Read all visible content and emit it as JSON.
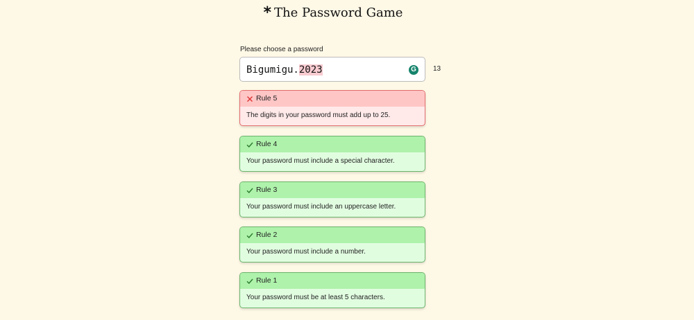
{
  "header": {
    "star": "*",
    "title": "The Password Game"
  },
  "password": {
    "label": "Please choose a password",
    "value_plain": "Bigumigu.",
    "value_highlighted": "2023",
    "char_count": "13",
    "assistant_icon": "G"
  },
  "rules": [
    {
      "status": "fail",
      "title": "Rule 5",
      "text": "The digits in your password must add up to 25."
    },
    {
      "status": "pass",
      "title": "Rule 4",
      "text": "Your password must include a special character."
    },
    {
      "status": "pass",
      "title": "Rule 3",
      "text": "Your password must include an uppercase letter."
    },
    {
      "status": "pass",
      "title": "Rule 2",
      "text": "Your password must include a number."
    },
    {
      "status": "pass",
      "title": "Rule 1",
      "text": "Your password must be at least 5 characters."
    }
  ],
  "colors": {
    "background": "#fef8e6",
    "fail_header": "#ffc6c6",
    "fail_body": "#ffe9e9",
    "pass_header": "#aef2ab",
    "pass_body": "#e1fde0",
    "digit_highlight": "#f7cbd0"
  },
  "icons": {
    "fail": "close-x-icon",
    "pass": "check-icon",
    "assistant": "grammarly-icon"
  }
}
